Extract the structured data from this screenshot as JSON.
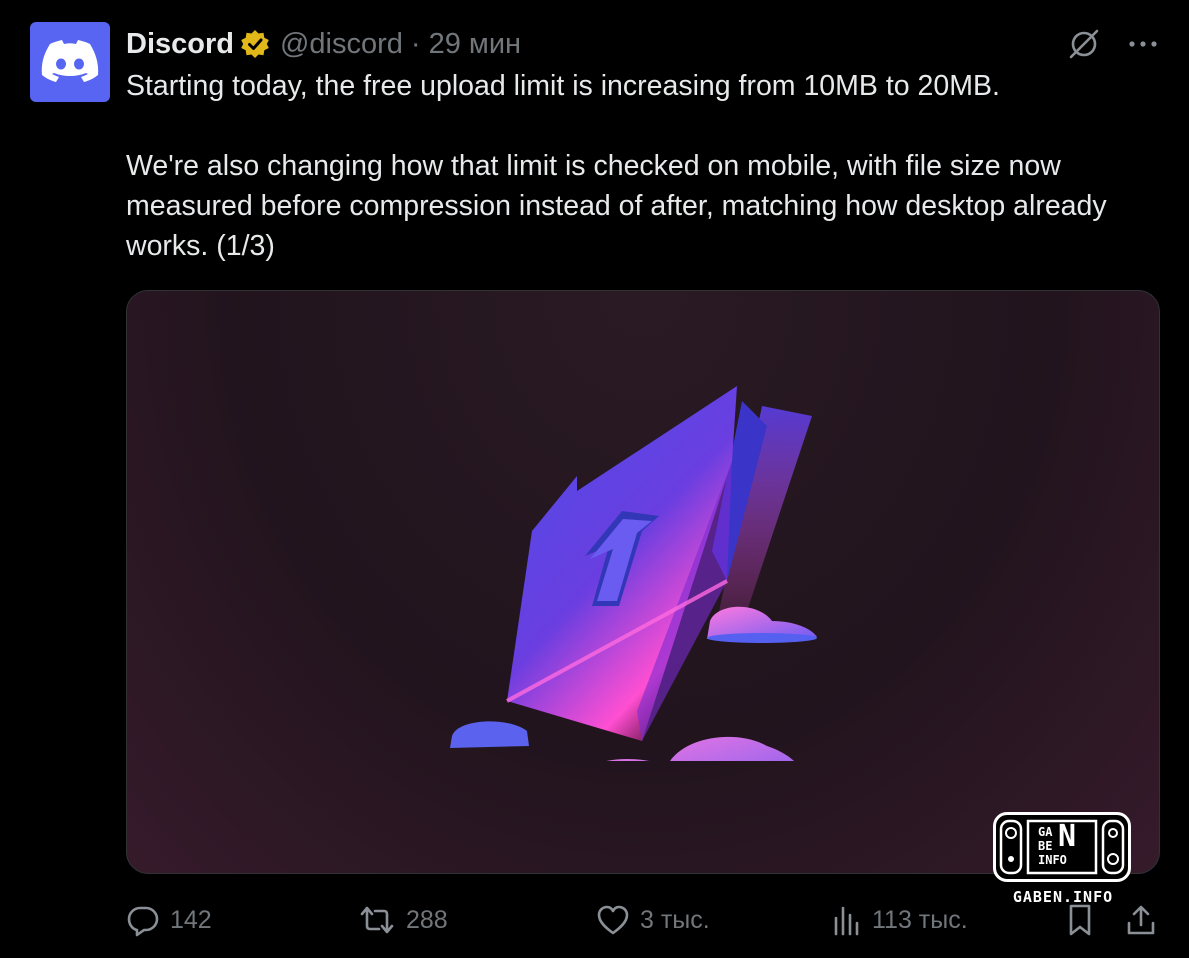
{
  "author": {
    "name": "Discord",
    "handle": "@discord",
    "separator": "·",
    "time": "29 мин",
    "avatar_color": "#5865f2",
    "verified_color": "#e2b719"
  },
  "icons": {
    "avatar": "discord-logo-icon",
    "verified": "verified-badge-icon",
    "grok": "grok-icon",
    "more": "more-icon",
    "reply": "reply-icon",
    "retweet": "retweet-icon",
    "like": "like-icon",
    "views": "views-icon",
    "bookmark": "bookmark-icon",
    "share": "share-icon"
  },
  "tweet": {
    "paragraph1": "Starting today, the free upload limit is increasing from 10MB to 20MB.",
    "paragraph2": "We're also changing how that limit is checked on mobile, with file size now measured before compression instead of after, matching how desktop already works. (1/3)"
  },
  "watermark": {
    "line1": "GA",
    "line2": "BE",
    "line3": "INFO",
    "big_letter": "N",
    "caption": "GABEN.INFO"
  },
  "actions": {
    "replies": "142",
    "retweets": "288",
    "likes": "3 тыс.",
    "views": "113 тыс."
  },
  "colors": {
    "background": "#000000",
    "text": "#e7e9ea",
    "muted": "#71767b",
    "accent": "#5865f2"
  }
}
